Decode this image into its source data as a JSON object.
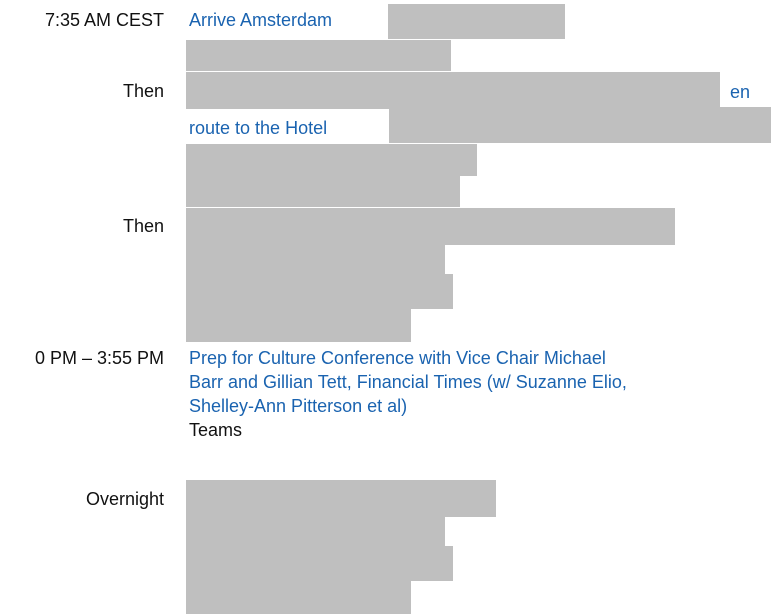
{
  "colors": {
    "link": "#1a63b0",
    "text": "#111111",
    "redaction": "#bfbfbf"
  },
  "schedule": {
    "row1": {
      "time": "7:35 AM CEST",
      "title": "Arrive Amsterdam"
    },
    "row2": {
      "time": "Then",
      "fragment_end": "en",
      "fragment_next": "route to the Hotel"
    },
    "row3": {
      "time": "Then"
    },
    "row4": {
      "time": "0 PM – 3:55 PM",
      "title_line1": "Prep for Culture Conference with Vice Chair Michael",
      "title_line2": "Barr and Gillian Tett, Financial Times (w/ Suzanne Elio,",
      "title_line3": "Shelley-Ann Pitterson et al)",
      "location": "Teams"
    },
    "row5": {
      "time": "Overnight"
    }
  }
}
